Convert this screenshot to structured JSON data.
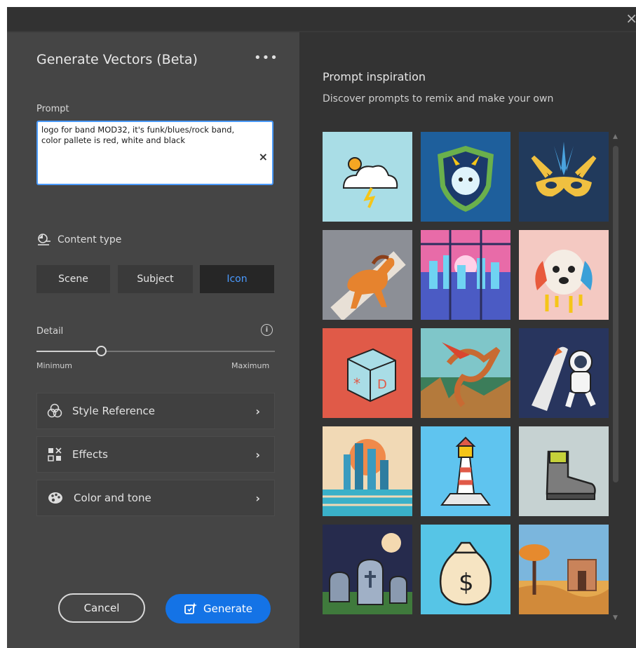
{
  "window": {
    "close_glyph": "×"
  },
  "panel": {
    "title": "Generate Vectors (Beta)",
    "more_glyph": "•••"
  },
  "prompt": {
    "label": "Prompt",
    "value": "logo for band MOD32, it's funk/blues/rock band, color pallete is red, white and black",
    "clear_glyph": "×"
  },
  "content_type": {
    "label": "Content type",
    "options": [
      "Scene",
      "Subject",
      "Icon"
    ],
    "selected": "Icon"
  },
  "detail": {
    "label": "Detail",
    "min_label": "Minimum",
    "max_label": "Maximum",
    "value_fraction": 0.27,
    "info_glyph": "i"
  },
  "sections": [
    {
      "label": "Style Reference",
      "icon": "style-reference-icon"
    },
    {
      "label": "Effects",
      "icon": "effects-icon"
    },
    {
      "label": "Color and tone",
      "icon": "palette-icon"
    }
  ],
  "chevron_glyph": "›",
  "buttons": {
    "cancel": "Cancel",
    "generate": "Generate"
  },
  "inspiration": {
    "title": "Prompt inspiration",
    "subtitle": "Discover prompts to remix and make your own",
    "tiles": [
      {
        "name": "weather-cloud",
        "bg": "#a9dde6"
      },
      {
        "name": "dragon-shield",
        "bg": "#1e5f9c"
      },
      {
        "name": "carnival-mask",
        "bg": "#213a5c"
      },
      {
        "name": "running-horse",
        "bg": "#8c8f96"
      },
      {
        "name": "city-window",
        "bg": "#3a3f8a"
      },
      {
        "name": "rainbow-dog",
        "bg": "#f4c9c2"
      },
      {
        "name": "toy-block",
        "bg": "#e05a48"
      },
      {
        "name": "fantasy-dragon",
        "bg": "#7fc6c9"
      },
      {
        "name": "astronaut-rocket",
        "bg": "#28355e"
      },
      {
        "name": "futuristic-city",
        "bg": "#f1d9b5"
      },
      {
        "name": "lighthouse",
        "bg": "#5fc4ef"
      },
      {
        "name": "hiking-boot",
        "bg": "#c6d2d2"
      },
      {
        "name": "graveyard-moon",
        "bg": "#262b4d"
      },
      {
        "name": "money-bag",
        "bg": "#56c5e6"
      },
      {
        "name": "desert-temple",
        "bg": "#7bb6dd"
      }
    ]
  },
  "colors": {
    "accent": "#1473e6",
    "selected_text": "#4a9aff",
    "panel_bg": "#454545",
    "right_bg": "#333333"
  }
}
